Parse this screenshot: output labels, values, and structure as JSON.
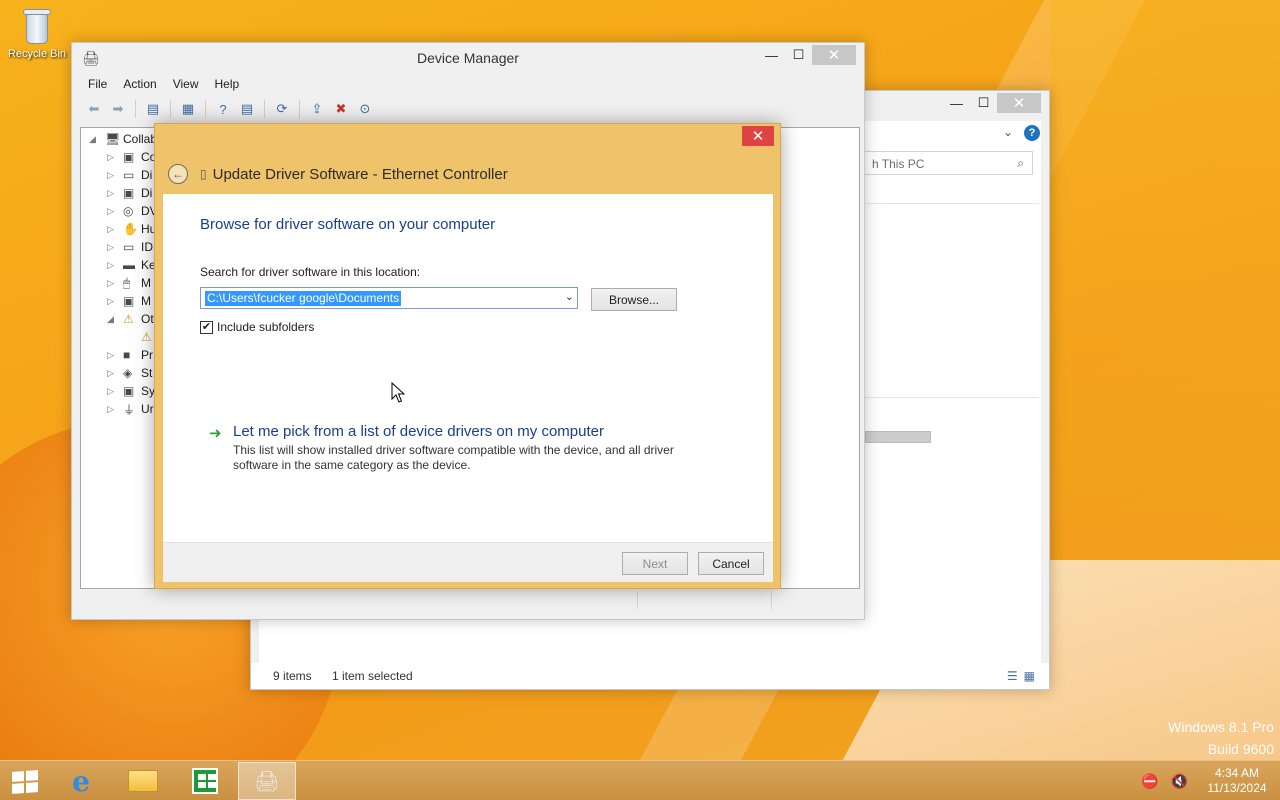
{
  "desktop": {
    "recycle_bin_label": "Recycle Bin",
    "watermark_line1": "Windows 8.1 Pro",
    "watermark_line2": "Build 9600"
  },
  "explorer": {
    "search_placeholder": "h This PC",
    "status_count": "9 items",
    "status_selected": "1 item selected",
    "icons": [
      "chevron-down-icon",
      "help-icon",
      "search-icon",
      "details-view-icon",
      "large-icons-view-icon"
    ]
  },
  "device_manager": {
    "title": "Device Manager",
    "menu": [
      "File",
      "Action",
      "View",
      "Help"
    ],
    "tree": [
      {
        "label": "Collab",
        "twisty": "◢",
        "icon": "computer-icon",
        "glyph": "🖥",
        "indent": 0
      },
      {
        "label": "Co",
        "twisty": "▷",
        "icon": "computer-icon",
        "glyph": "▣",
        "indent": 1
      },
      {
        "label": "Di",
        "twisty": "▷",
        "icon": "disk-drive-icon",
        "glyph": "▭",
        "indent": 1
      },
      {
        "label": "Di",
        "twisty": "▷",
        "icon": "display-adapter-icon",
        "glyph": "▣",
        "indent": 1
      },
      {
        "label": "DV",
        "twisty": "▷",
        "icon": "dvd-drive-icon",
        "glyph": "◎",
        "indent": 1
      },
      {
        "label": "Hu",
        "twisty": "▷",
        "icon": "hid-icon",
        "glyph": "✋",
        "indent": 1
      },
      {
        "label": "ID",
        "twisty": "▷",
        "icon": "ide-controller-icon",
        "glyph": "▭",
        "indent": 1
      },
      {
        "label": "Ke",
        "twisty": "▷",
        "icon": "keyboard-icon",
        "glyph": "▬",
        "indent": 1
      },
      {
        "label": "M",
        "twisty": "▷",
        "icon": "mouse-icon",
        "glyph": "🖱",
        "indent": 1
      },
      {
        "label": "M",
        "twisty": "▷",
        "icon": "monitor-icon",
        "glyph": "▣",
        "indent": 1
      },
      {
        "label": "Ot",
        "twisty": "◢",
        "icon": "other-devices-icon",
        "glyph": "⚠",
        "indent": 1
      },
      {
        "label": "",
        "twisty": "",
        "icon": "unknown-device-icon",
        "glyph": "⚠",
        "indent": 2
      },
      {
        "label": "Pr",
        "twisty": "▷",
        "icon": "processor-icon",
        "glyph": "■",
        "indent": 1
      },
      {
        "label": "St",
        "twisty": "▷",
        "icon": "storage-controller-icon",
        "glyph": "◈",
        "indent": 1
      },
      {
        "label": "Sy",
        "twisty": "▷",
        "icon": "system-devices-icon",
        "glyph": "▣",
        "indent": 1
      },
      {
        "label": "Ur",
        "twisty": "▷",
        "icon": "usb-icon",
        "glyph": "⏚",
        "indent": 1
      }
    ]
  },
  "dialog": {
    "title": "Update Driver Software - Ethernet Controller",
    "heading": "Browse for driver software on your computer",
    "search_label": "Search for driver software in this location:",
    "path_value": "C:\\Users\\fcucker google\\Documents",
    "browse_label": "Browse...",
    "include_subfolders_label": "Include subfolders",
    "include_subfolders_checked": true,
    "pick_link": "Let me pick from a list of device drivers on my computer",
    "pick_desc": "This list will show installed driver software compatible with the device, and all driver software in the same category as the device.",
    "next_label": "Next",
    "cancel_label": "Cancel"
  },
  "taskbar": {
    "time": "4:34 AM",
    "date": "11/13/2024",
    "items": [
      "start-button",
      "internet-explorer",
      "file-explorer",
      "windows-store",
      "device-manager"
    ]
  }
}
